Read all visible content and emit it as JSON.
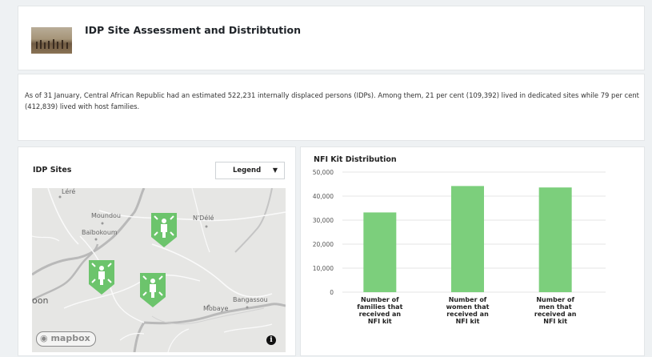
{
  "header": {
    "title": "IDP Site Assessment and Distribtution"
  },
  "description": {
    "text": "As of 31 January, Central African Republic had an estimated 522,231 internally displaced persons (IDPs). Among them, 21 per cent (109,392) lived in dedicated sites while 79 per cent (412,839) lived with host families."
  },
  "map_panel": {
    "title": "IDP Sites",
    "legend_select": {
      "selected": "Legend"
    },
    "places": {
      "lere": "Léré",
      "moundou": "Moundou",
      "baibokoum": "Baïbokoum",
      "ndele": "N'Délé",
      "bangassou": "Bangassou",
      "mobaye": "Mobaye",
      "oon": "oon"
    },
    "attribution": "mapbox",
    "info_icon": "i",
    "marker_color": "#6cc46c"
  },
  "chart_panel": {
    "title": "NFI Kit Distribution"
  },
  "chart_data": {
    "type": "bar",
    "categories": [
      [
        "Number of",
        "families that",
        "received an",
        "NFI kit"
      ],
      [
        "Number of",
        "women that",
        "received an",
        "NFI kit"
      ],
      [
        "Number of",
        "men that",
        "received an",
        "NFI kit"
      ]
    ],
    "values": [
      33200,
      44200,
      43600
    ],
    "ylim": [
      0,
      50000
    ],
    "yticks": [
      "50,000",
      "40,000",
      "30,000",
      "20,000",
      "10,000",
      "0"
    ],
    "ytick_values": [
      50000,
      40000,
      30000,
      20000,
      10000,
      0
    ],
    "bar_color": "#7ccf7c",
    "grid": true
  }
}
